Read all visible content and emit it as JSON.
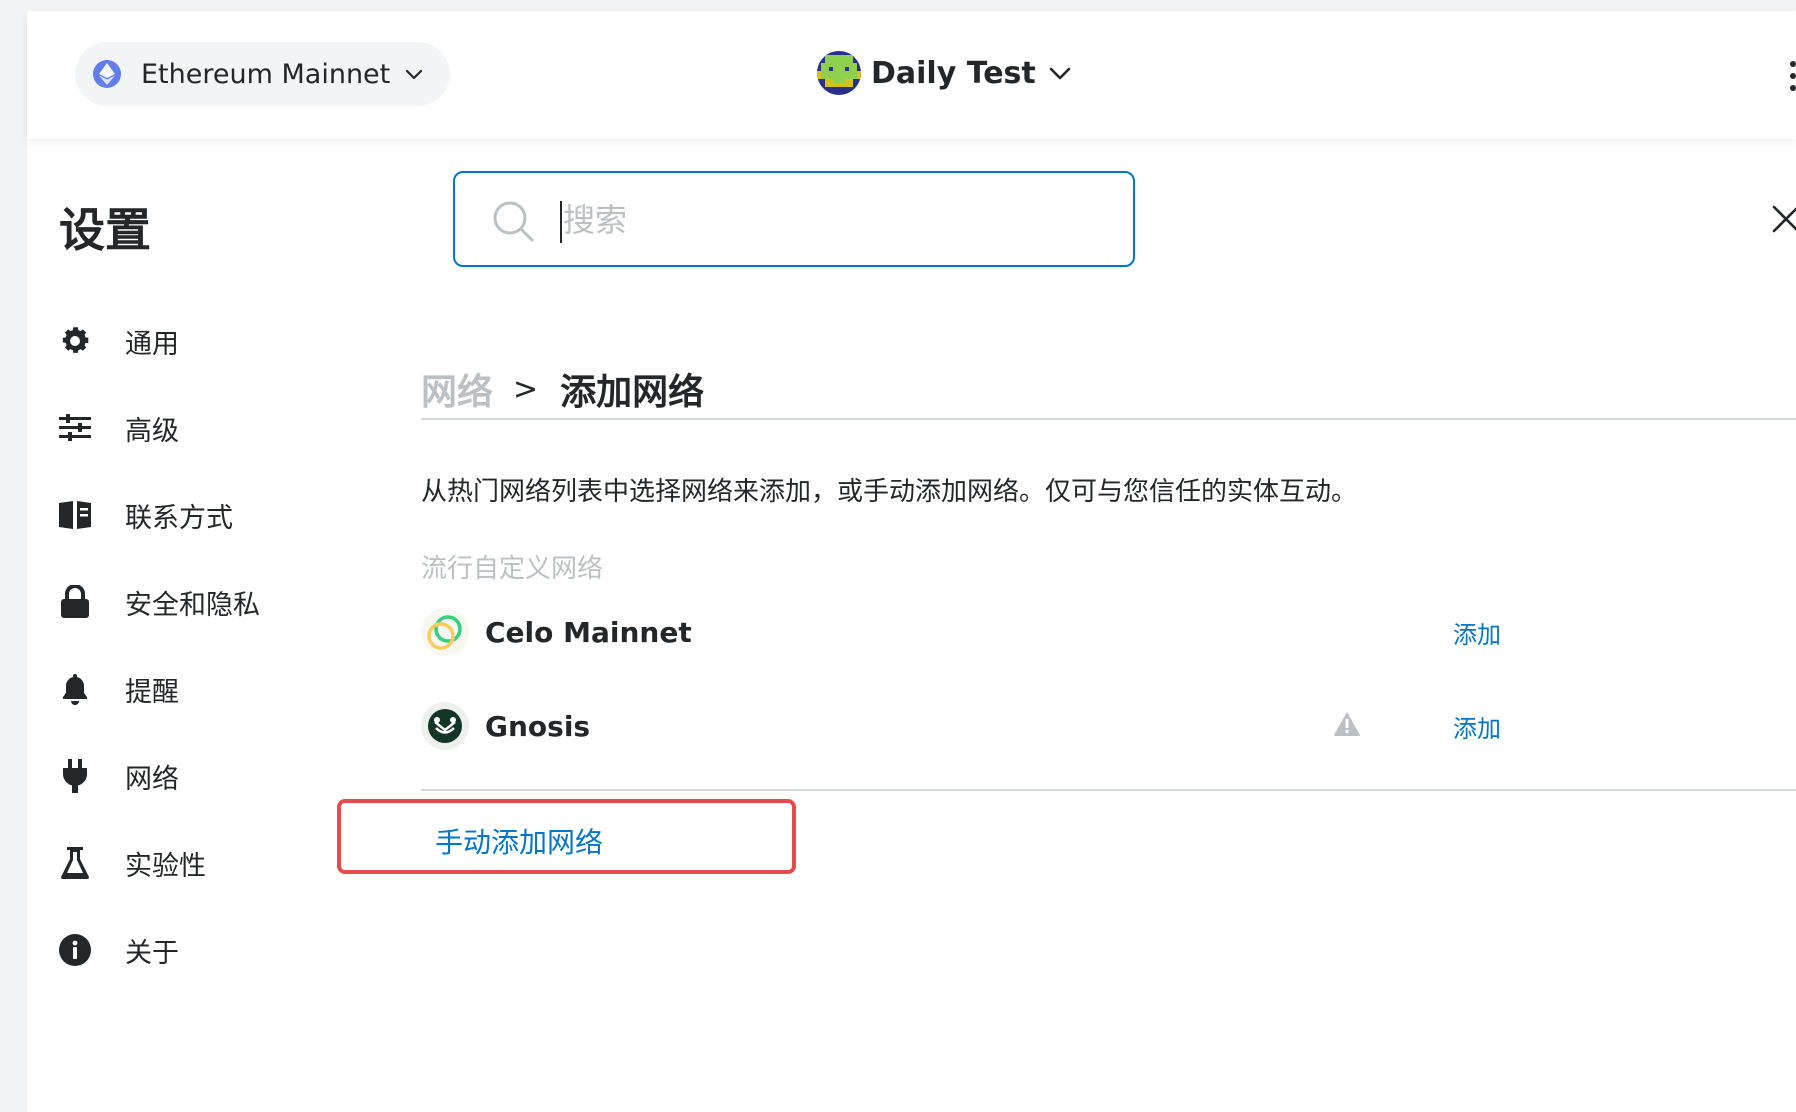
{
  "header": {
    "network_name": "Ethereum Mainnet",
    "account_name": "Daily Test"
  },
  "settings": {
    "title": "设置",
    "search_placeholder": "搜索"
  },
  "sidebar": {
    "items": [
      {
        "label": "通用",
        "icon": "gear-icon"
      },
      {
        "label": "高级",
        "icon": "sliders-icon"
      },
      {
        "label": "联系方式",
        "icon": "book-icon"
      },
      {
        "label": "安全和隐私",
        "icon": "lock-icon"
      },
      {
        "label": "提醒",
        "icon": "bell-icon"
      },
      {
        "label": "网络",
        "icon": "plug-icon"
      },
      {
        "label": "实验性",
        "icon": "flask-icon"
      },
      {
        "label": "关于",
        "icon": "info-icon"
      }
    ]
  },
  "content": {
    "breadcrumb_parent": "网络",
    "breadcrumb_separator": ">",
    "breadcrumb_current": "添加网络",
    "description": "从热门网络列表中选择网络来添加，或手动添加网络。仅可与您信任的实体互动。",
    "section_label": "流行自定义网络",
    "networks": [
      {
        "name": "Celo Mainnet",
        "add_label": "添加",
        "warning": false
      },
      {
        "name": "Gnosis",
        "add_label": "添加",
        "warning": true
      }
    ],
    "manual_add_label": "手动添加网络"
  },
  "colors": {
    "accent": "#0376c9",
    "highlight": "#e64b4b",
    "muted": "#bbc0c5",
    "text": "#24272a"
  }
}
